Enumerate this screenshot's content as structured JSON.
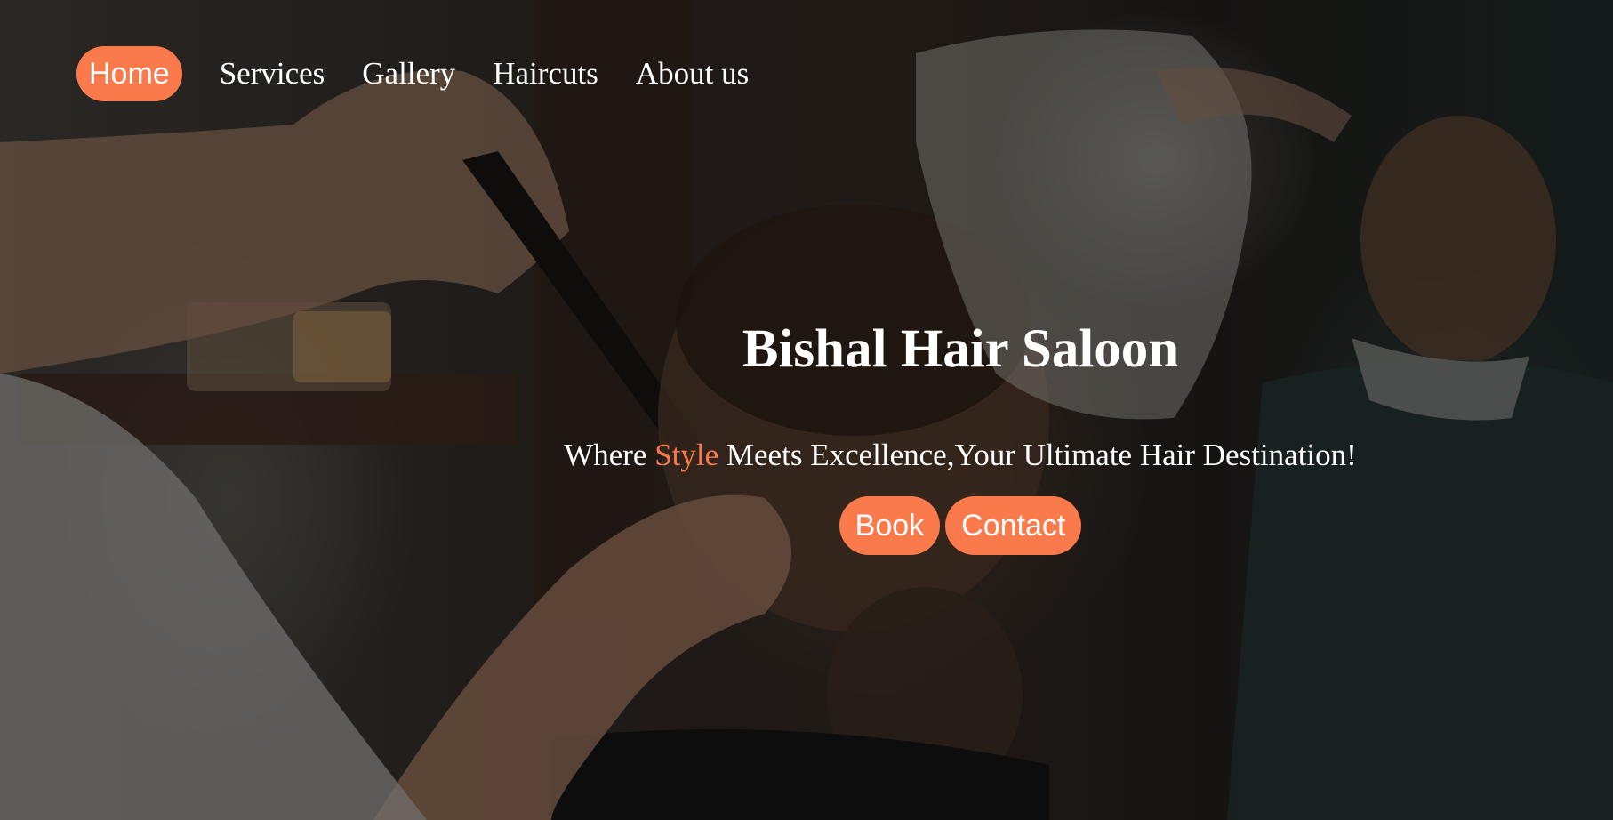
{
  "nav": {
    "items": [
      {
        "label": "Home",
        "active": true
      },
      {
        "label": "Services",
        "active": false
      },
      {
        "label": "Gallery",
        "active": false
      },
      {
        "label": "Haircuts",
        "active": false
      },
      {
        "label": "About us",
        "active": false
      }
    ]
  },
  "hero": {
    "title": "Bishal Hair Saloon",
    "tagline_before": "Where ",
    "tagline_accent": "Style",
    "tagline_after": " Meets Excellence,Your Ultimate Hair Destination!",
    "book_label": "Book",
    "contact_label": "Contact"
  },
  "colors": {
    "accent": "#fb7a4c",
    "text": "#ffffff"
  }
}
